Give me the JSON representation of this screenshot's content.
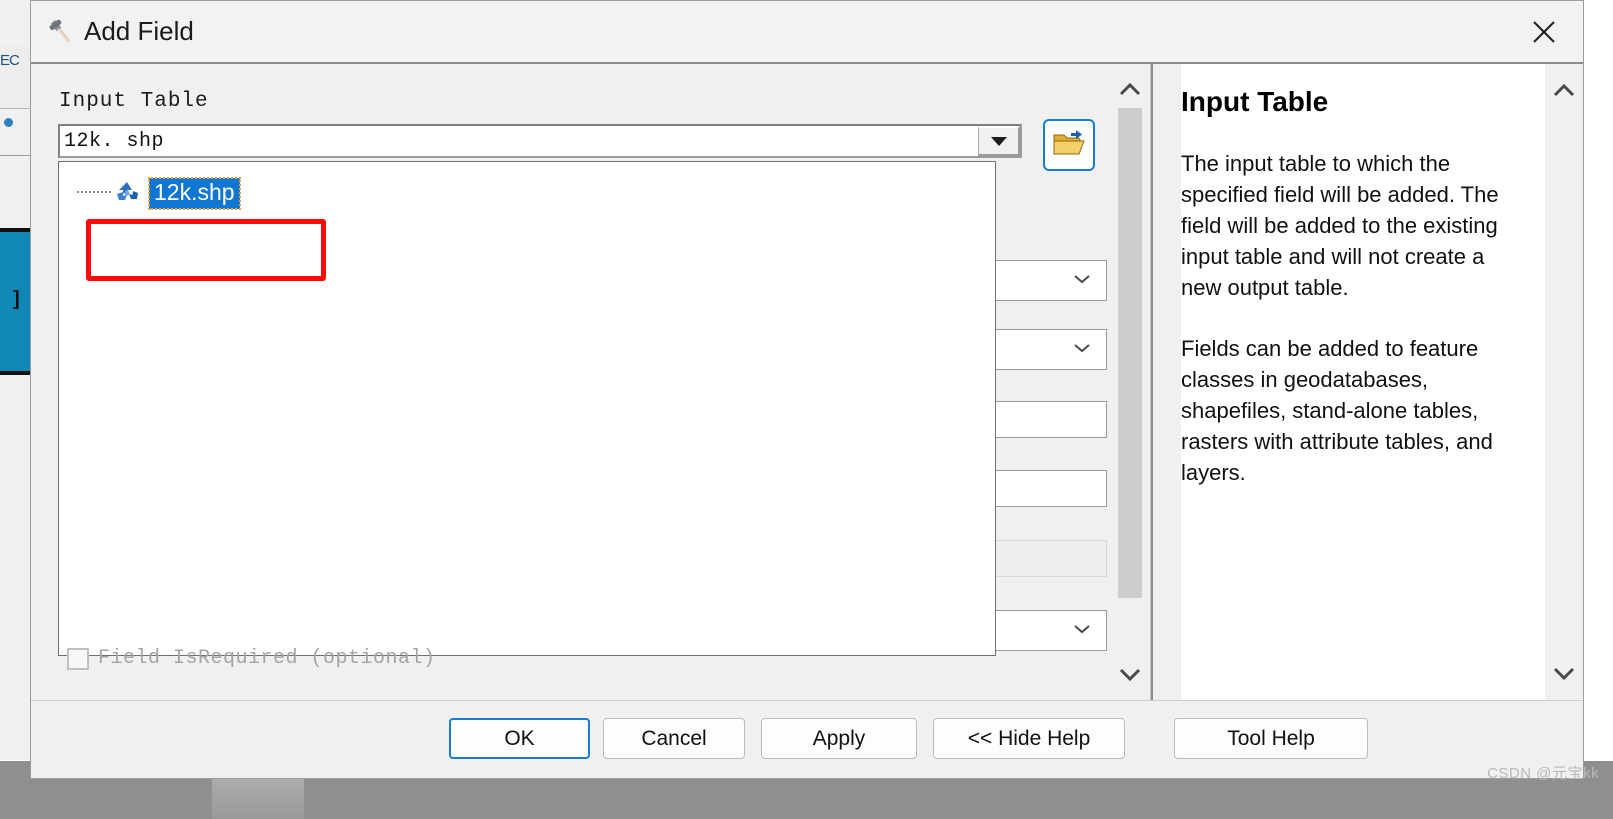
{
  "window": {
    "title": "Add Field",
    "title_icon": "hammer-tool-icon",
    "close_icon": "close-icon"
  },
  "form": {
    "input_table_label": "Input Table",
    "input_table_value": "12k. shp",
    "input_table_placeholder": "",
    "dropdown_arrow_icon": "chevron-down-icon",
    "browse_icon": "open-folder-icon",
    "dropdown": {
      "items": [
        {
          "label": "12k.shp",
          "icon": "shapefile-polygon-icon",
          "selected": true
        }
      ]
    },
    "checkbox": {
      "label": "Field IsRequired (optional)",
      "checked": false,
      "enabled": false
    },
    "scrollbar": {
      "up_icon": "chevron-up-icon",
      "down_icon": "chevron-down-icon"
    }
  },
  "help": {
    "title": "Input Table",
    "paragraphs": [
      "The input table to which the specified field will be added. The field will be added to the existing input table and will not create a new output table.",
      "Fields can be added to feature classes in geodatabases, shapefiles, stand-alone tables, rasters with attribute tables, and layers."
    ],
    "scrollbar": {
      "up_icon": "chevron-up-icon",
      "down_icon": "chevron-down-icon"
    }
  },
  "footer": {
    "ok": "OK",
    "cancel": "Cancel",
    "apply": "Apply",
    "hide_help": "<< Hide Help",
    "tool_help": "Tool Help"
  },
  "background": {
    "left_label": "EC",
    "selected_glyph": "]"
  },
  "watermark": "CSDN @元宝kk",
  "colors": {
    "accent_focus": "#1a7bd4",
    "selection_blue": "#0f77d1",
    "annotation_red": "#fc0b0b",
    "dialog_bg": "#f0f0f0",
    "bg_selected_teal": "#1088b5"
  }
}
